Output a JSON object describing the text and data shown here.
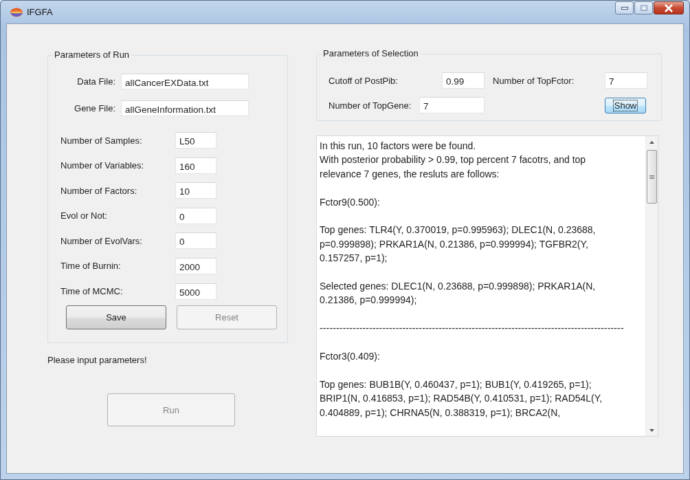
{
  "window": {
    "title": "IFGFA"
  },
  "run_group": {
    "title": "Parameters of Run",
    "files": [
      {
        "label": "Data File:",
        "value": "allCancerEXData.txt"
      },
      {
        "label": "Gene File:",
        "value": "allGeneInformation.txt"
      }
    ],
    "params": [
      {
        "label": "Number of Samples:",
        "value": "L50"
      },
      {
        "label": "Number of Variables:",
        "value": "160"
      },
      {
        "label": "Number of Factors:",
        "value": "10"
      },
      {
        "label": "Evol or Not:",
        "value": "0"
      },
      {
        "label": "Number of EvolVars:",
        "value": "0"
      },
      {
        "label": "Time of Burnin:",
        "value": "2000"
      },
      {
        "label": "Time of MCMC:",
        "value": "5000"
      }
    ],
    "buttons": [
      {
        "label": "Save",
        "disabled": false
      },
      {
        "label": "Reset",
        "disabled": true
      }
    ]
  },
  "status": "Please input parameters!",
  "run_button": {
    "label": "Run",
    "disabled": true
  },
  "selection_group": {
    "title": "Parameters of Selection",
    "fields": [
      {
        "label": "Cutoff of PostPib:",
        "value": "0.99"
      },
      {
        "label": "Number of TopFctor:",
        "value": "7"
      },
      {
        "label": "Number of TopGene:",
        "value": "7"
      }
    ],
    "show_button": {
      "label": "Show",
      "focused": true
    }
  },
  "output": {
    "blocks": [
      [
        "In this run, 10 factors were be found.",
        "With posterior probability > 0.99, top percent 7 facotrs, and top relevance 7 genes, the resluts are follows:"
      ],
      [
        "Fctor9(0.500):"
      ],
      [
        "Top genes: TLR4(Y, 0.370019, p=0.995963); DLEC1(N, 0.23688, p=0.999898); PRKAR1A(N, 0.21386, p=0.999994); TGFBR2(Y, 0.157257, p=1);"
      ],
      [
        "Selected genes: DLEC1(N, 0.23688, p=0.999898); PRKAR1A(N, 0.21386, p=0.999994);"
      ],
      [
        "--------------------------------------------------------------------------------------------"
      ],
      [
        "Fctor3(0.409):"
      ],
      [
        "Top genes: BUB1B(Y, 0.460437, p=1); BUB1(Y, 0.419265, p=1); BRIP1(N, 0.416853, p=1); RAD54B(Y, 0.410531, p=1); RAD54L(Y, 0.404889, p=1); CHRNA5(N, 0.388319, p=1); BRCA2(N,"
      ]
    ]
  }
}
